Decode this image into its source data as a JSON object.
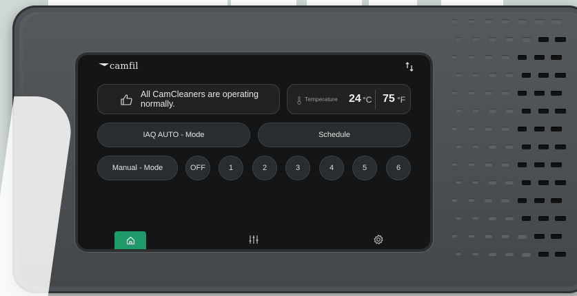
{
  "brand": {
    "logo_text": "camfil"
  },
  "status": {
    "message": "All CamCleaners are operating normally."
  },
  "temperature": {
    "label": "Temperature",
    "celsius": "24",
    "celsius_unit": "°C",
    "fahrenheit": "75",
    "fahrenheit_unit": "°F"
  },
  "modes": {
    "iaq_auto": "IAQ AUTO - Mode",
    "schedule": "Schedule",
    "manual": "Manual - Mode"
  },
  "fan_speeds": [
    "OFF",
    "1",
    "2",
    "3",
    "4",
    "5",
    "6"
  ],
  "nav": {
    "active": "home",
    "items": [
      "home-icon",
      "sliders-icon",
      "gear-icon"
    ]
  },
  "colors": {
    "accent": "#1f9b6b",
    "screen_bg": "#141516",
    "device_body": "#46494c"
  }
}
